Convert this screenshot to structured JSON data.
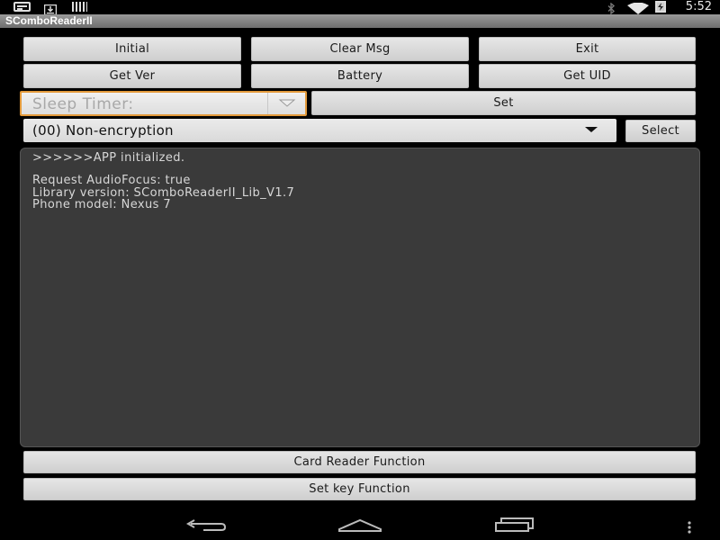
{
  "status_bar": {
    "clock": "5:52",
    "icons": [
      "notification-icon",
      "download-icon",
      "barcode-icon",
      "bluetooth-icon",
      "wifi-icon",
      "battery-icon"
    ]
  },
  "app": {
    "title": "SComboReaderII"
  },
  "buttons": {
    "initial": "Initial",
    "clear_msg": "Clear Msg",
    "exit": "Exit",
    "get_ver": "Get Ver",
    "battery": "Battery",
    "get_uid": "Get UID",
    "set": "Set",
    "select": "Select",
    "card_reader_function": "Card Reader Function",
    "set_key_function": "Set key Function"
  },
  "sleep_timer": {
    "placeholder": "Sleep Timer:"
  },
  "encryption": {
    "selected": "(00) Non-encryption"
  },
  "messages": {
    "lines": [
      ">>>>>>APP initialized.",
      "Request AudioFocus: true",
      "Library version: SComboReaderII_Lib_V1.7",
      "Phone model: Nexus 7"
    ]
  },
  "nav_bar": {
    "icons": [
      "back-icon",
      "home-icon",
      "recent-apps-icon",
      "overflow-menu-icon"
    ]
  },
  "colors": {
    "focus_accent": "#e39a3b",
    "message_background": "#3a3a3a",
    "button_background": "#dcdcdc"
  }
}
